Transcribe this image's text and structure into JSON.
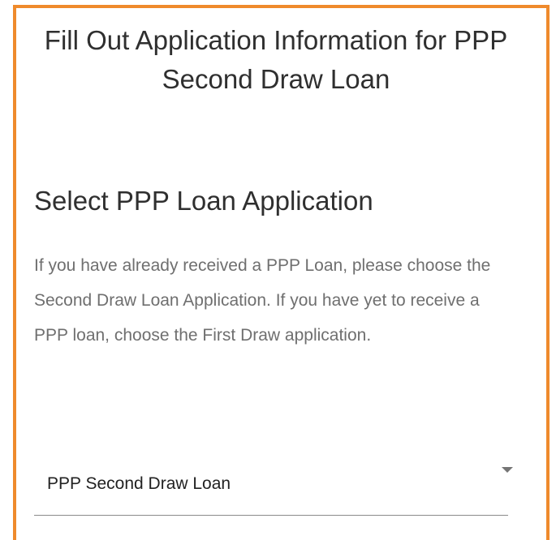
{
  "page": {
    "title": "Fill Out Application Information for PPP Second Draw Loan"
  },
  "section": {
    "heading": "Select PPP Loan Application",
    "description": "If you have already received a PPP Loan, please choose the Second Draw Loan Application. If you have yet to receive a PPP loan, choose the First Draw application."
  },
  "loan_select": {
    "selected_value": "PPP Second Draw Loan",
    "arrow_icon": "chevron-down-icon"
  },
  "colors": {
    "panel_border": "#ef8a2c",
    "heading_text": "#2f2f2f",
    "description_text": "#6f6f6f"
  }
}
